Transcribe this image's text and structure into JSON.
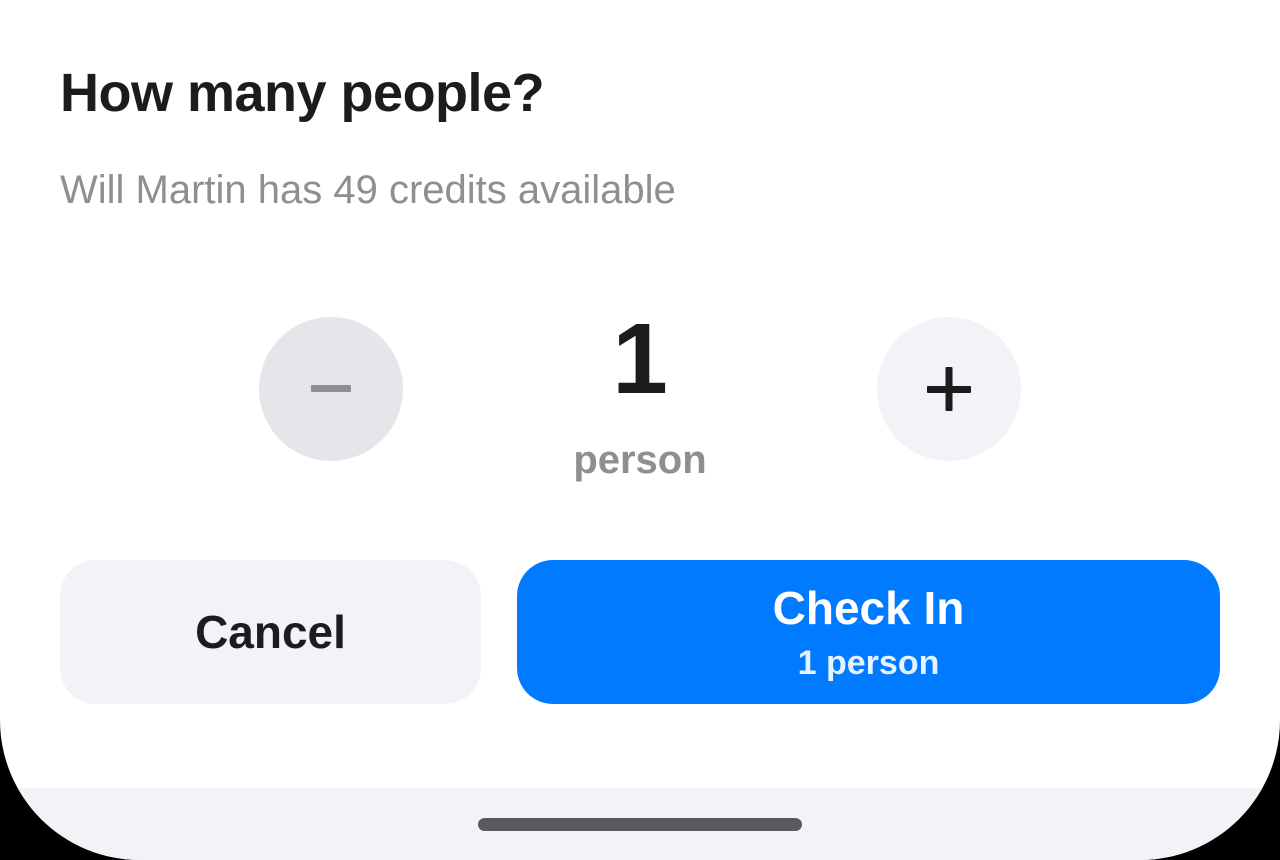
{
  "dialog": {
    "title": "How many people?",
    "subtitle": "Will Martin has 49 credits available"
  },
  "stepper": {
    "count": "1",
    "unit": "person",
    "decrement_icon": "minus-icon",
    "increment_icon": "plus-icon",
    "decrement_enabled": false
  },
  "actions": {
    "cancel_label": "Cancel",
    "checkin_label": "Check In",
    "checkin_sublabel": "1 person"
  },
  "colors": {
    "accent": "#007aff",
    "title_text": "#1c1c1e",
    "secondary_text": "#8e8e93",
    "neutral_button": "#f2f2f7",
    "disabled_button": "#e5e5ea"
  }
}
